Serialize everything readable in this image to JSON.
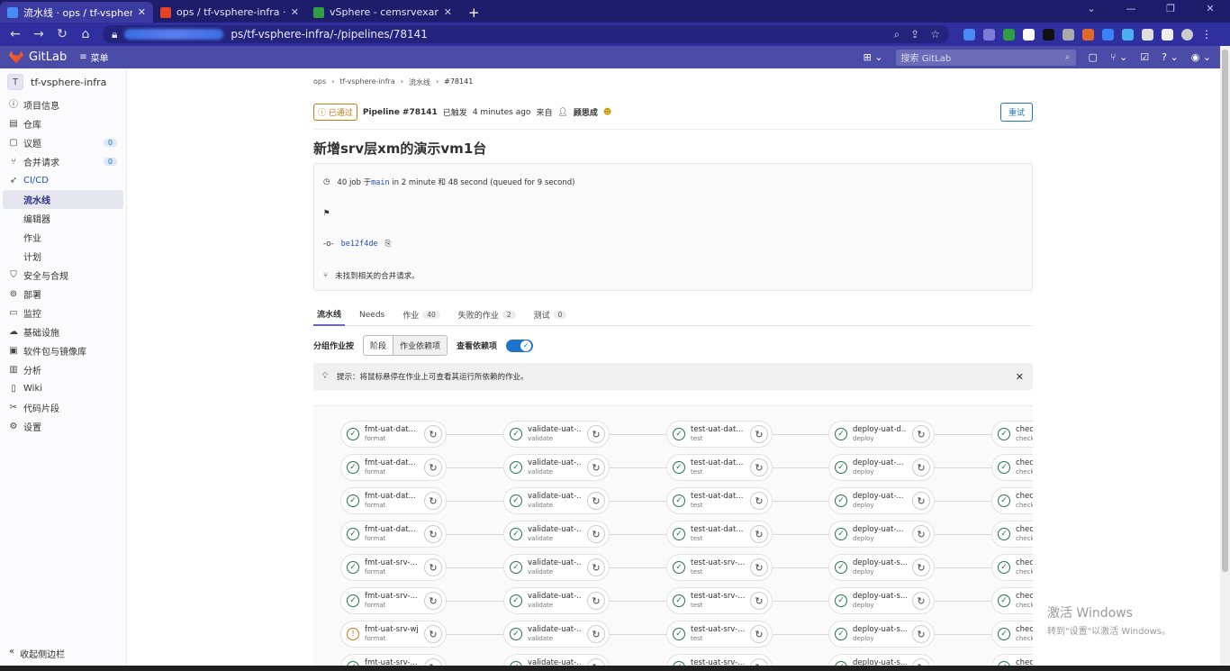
{
  "browser": {
    "tabs": [
      {
        "title": "流水线 · ops / tf-vsphere-infra",
        "color": "#4a8af4",
        "active": true
      },
      {
        "title": "ops / tf-vsphere-infra · GitLab",
        "color": "#e24329",
        "active": false
      },
      {
        "title": "vSphere - cemsrvexample-srv",
        "color": "#2f9e44",
        "active": false
      }
    ],
    "url": "ps/tf-vsphere-infra/-/pipelines/78141"
  },
  "header": {
    "logo": "GitLab",
    "menu": "菜单",
    "search_placeholder": "搜索 GitLab"
  },
  "sidebar": {
    "project": {
      "avatar": "T",
      "name": "tf-vsphere-infra"
    },
    "items": [
      {
        "label": "项目信息",
        "icon": "info-icon"
      },
      {
        "label": "仓库",
        "icon": "repo-icon"
      },
      {
        "label": "议题",
        "icon": "issues-icon",
        "count": "0"
      },
      {
        "label": "合并请求",
        "icon": "merge-request-icon",
        "count": "0"
      },
      {
        "label": "CI/CD",
        "icon": "rocket-icon",
        "current": true
      },
      {
        "label": "流水线",
        "sub": true,
        "active": true
      },
      {
        "label": "编辑器",
        "sub": true
      },
      {
        "label": "作业",
        "sub": true
      },
      {
        "label": "计划",
        "sub": true
      },
      {
        "label": "安全与合规",
        "icon": "shield-icon"
      },
      {
        "label": "部署",
        "icon": "deploy-icon"
      },
      {
        "label": "监控",
        "icon": "monitor-icon"
      },
      {
        "label": "基础设施",
        "icon": "cloud-icon"
      },
      {
        "label": "软件包与镜像库",
        "icon": "package-icon"
      },
      {
        "label": "分析",
        "icon": "chart-icon"
      },
      {
        "label": "Wiki",
        "icon": "book-icon"
      },
      {
        "label": "代码片段",
        "icon": "snippet-icon"
      },
      {
        "label": "设置",
        "icon": "gear-icon"
      }
    ],
    "collapse": "收起侧边栏"
  },
  "breadcrumbs": [
    "ops",
    "tf-vsphere-infra",
    "流水线",
    "#78141"
  ],
  "pipeline": {
    "status": "已通过",
    "label": "Pipeline #78141",
    "triggered": "已触发",
    "ago": "4 minutes ago",
    "from": "来自",
    "user": "顾思成",
    "retry": "重试",
    "title": "新增srv层xm的演示vm1台",
    "summary_prefix": "40 job 于",
    "branch": "main",
    "summary_suffix": "in 2 minute 和 48 second (queued for 9 second)",
    "commit": "be12f4de",
    "mr_note": "未找到相关的合并请求。"
  },
  "tabs": [
    {
      "label": "流水线",
      "active": true
    },
    {
      "label": "Needs"
    },
    {
      "label": "作业",
      "count": "40"
    },
    {
      "label": "失败的作业",
      "count": "2"
    },
    {
      "label": "测试",
      "count": "0"
    }
  ],
  "groupby": {
    "label": "分组作业按",
    "opt1": "阶段",
    "opt2": "作业依赖项",
    "toggle_label": "查看依赖项"
  },
  "tip": "提示：将鼠标悬停在作业上可查看其运行所依赖的作业。",
  "stages": [
    {
      "stage": "format",
      "jobs": [
        "fmt-uat-dat...",
        "fmt-uat-dat...",
        "fmt-uat-dat...",
        "fmt-uat-dat...",
        "fmt-uat-srv-...",
        "fmt-uat-srv-...",
        "fmt-uat-srv-wj",
        "fmt-uat-srv-..."
      ]
    },
    {
      "stage": "validate",
      "jobs": [
        "validate-uat-...",
        "validate-uat-...",
        "validate-uat-...",
        "validate-uat-...",
        "validate-uat-...",
        "validate-uat-...",
        "validate-uat-...",
        "validate-uat-..."
      ]
    },
    {
      "stage": "test",
      "jobs": [
        "test-uat-dat...",
        "test-uat-dat...",
        "test-uat-dat...",
        "test-uat-dat...",
        "test-uat-srv-...",
        "test-uat-srv-...",
        "test-uat-srv-...",
        "test-uat-srv-..."
      ]
    },
    {
      "stage": "deploy",
      "jobs": [
        "deploy-uat-d...",
        "deploy-uat-...",
        "deploy-uat-...",
        "deploy-uat-...",
        "deploy-uat-s...",
        "deploy-uat-s...",
        "deploy-uat-s...",
        "deploy-uat-s..."
      ]
    },
    {
      "stage": "check",
      "jobs": [
        "chec",
        "chec",
        "chec",
        "chec",
        "chec",
        "chec",
        "chec",
        "chec"
      ]
    }
  ],
  "warn_job": {
    "stage": 0,
    "row": 6
  },
  "watermark": {
    "line1": "激活 Windows",
    "line2": "转到\"设置\"以激活 Windows。"
  }
}
